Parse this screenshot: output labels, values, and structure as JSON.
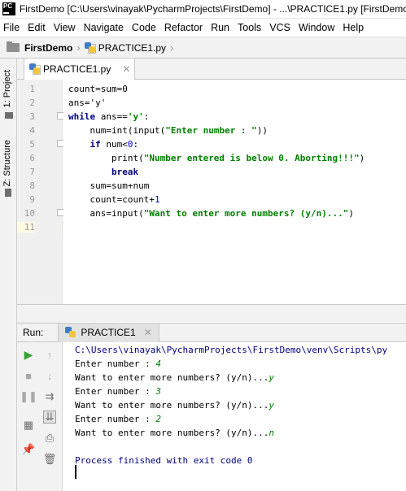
{
  "window": {
    "title": "FirstDemo [C:\\Users\\vinayak\\PycharmProjects\\FirstDemo] - ...\\PRACTICE1.py [FirstDemo]"
  },
  "menu": [
    "File",
    "Edit",
    "View",
    "Navigate",
    "Code",
    "Refactor",
    "Run",
    "Tools",
    "VCS",
    "Window",
    "Help"
  ],
  "breadcrumb": {
    "project": "FirstDemo",
    "file": "PRACTICE1.py"
  },
  "side_tabs": {
    "project": "1: Project",
    "structure": "Z: Structure"
  },
  "editor": {
    "tab_label": "PRACTICE1.py",
    "line_numbers": [
      "1",
      "2",
      "3",
      "4",
      "5",
      "6",
      "7",
      "8",
      "9",
      "10",
      "11"
    ]
  },
  "code": {
    "l1": "count=sum=0",
    "l2": "ans='y'",
    "l3_kw": "while",
    "l3_a": " ans==",
    "l3_s": "'y'",
    "l3_b": ":",
    "l4_a": "    num=int(input(",
    "l4_s": "\"Enter number : \"",
    "l4_b": "))",
    "l5_kw": "    if",
    "l5_a": " num<",
    "l5_n": "0",
    "l5_b": ":",
    "l6_a": "        print(",
    "l6_s": "\"Number entered is below 0. Aborting!!!\"",
    "l6_b": ")",
    "l7_kw": "        break",
    "l8": "    sum=sum+num",
    "l9_a": "    count=count+",
    "l9_n": "1",
    "l10_a": "    ans=input(",
    "l10_s": "\"Want to enter more numbers? (y/n)...\"",
    "l10_b": ")"
  },
  "run": {
    "label": "Run:",
    "tab_label": "PRACTICE1",
    "output": {
      "path": "C:\\Users\\vinayak\\PycharmProjects\\FirstDemo\\venv\\Scripts\\py",
      "p1": "Enter number : ",
      "i1": "4",
      "p2": "Want to enter more numbers? (y/n)...",
      "i2": "y",
      "p3": "Enter number : ",
      "i3": "3",
      "p4": "Want to enter more numbers? (y/n)...",
      "i4": "y",
      "p5": "Enter number : ",
      "i5": "2",
      "p6": "Want to enter more numbers? (y/n)...",
      "i6": "n",
      "done": "Process finished with exit code 0"
    }
  },
  "colors": {
    "keyword": "#000080",
    "string": "#008000",
    "number": "#0000ff",
    "current_line": "#fffae3"
  }
}
